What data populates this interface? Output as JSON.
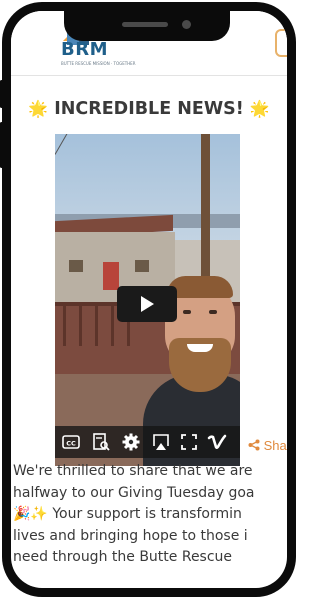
{
  "header": {
    "logo_text": "BRM",
    "logo_tagline": "BUTTE RESCUE MISSION · TOGETHER"
  },
  "post": {
    "headline_emoji_left": "🌟",
    "headline_text": "INCREDIBLE NEWS!",
    "headline_emoji_right": "🌟",
    "share_label": "Sha",
    "body_lines": [
      "We're thrilled to share that we are",
      "halfway to our Giving Tuesday goa",
      "🎉✨ Your support is transformin",
      "lives and bringing hope to those i",
      "need through the Butte Rescue"
    ]
  },
  "video": {
    "controls": [
      "cc-icon",
      "transcript-icon",
      "settings-icon",
      "airplay-icon",
      "fullscreen-icon",
      "vimeo-icon"
    ]
  },
  "colors": {
    "brand_blue": "#1f5f8a",
    "accent_orange": "#e08a3e",
    "text": "#3a3a3a"
  }
}
